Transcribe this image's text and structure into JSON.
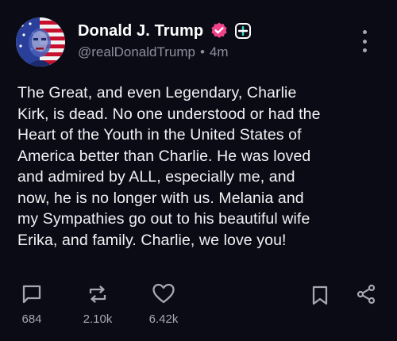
{
  "author": {
    "display_name": "Donald J. Trump",
    "handle": "@realDonaldTrump",
    "timestamp": "4m",
    "separator": "•"
  },
  "post": {
    "text": "The Great, and even Legendary, Charlie\nKirk, is dead. No one understood or had the\nHeart of the Youth in the United States of\nAmerica better than Charlie. He was loved\nand admired by ALL, especially me, and\nnow, he is no longer with us. Melania and\nmy Sympathies go out to his beautiful wife\nErika, and family. Charlie, we love you!"
  },
  "actions": {
    "replies": "684",
    "reposts": "2.10k",
    "likes": "6.42k"
  },
  "colors": {
    "background": "#0b0b16",
    "verified_badge": "#f0448a",
    "plus_badge_accent": "#39d8c5",
    "muted_text": "#8d8d9c"
  },
  "icons": [
    "verified-badge-icon",
    "plus-badge-icon",
    "more-options-icon",
    "reply-icon",
    "repost-icon",
    "like-icon",
    "bookmark-icon",
    "share-icon"
  ]
}
